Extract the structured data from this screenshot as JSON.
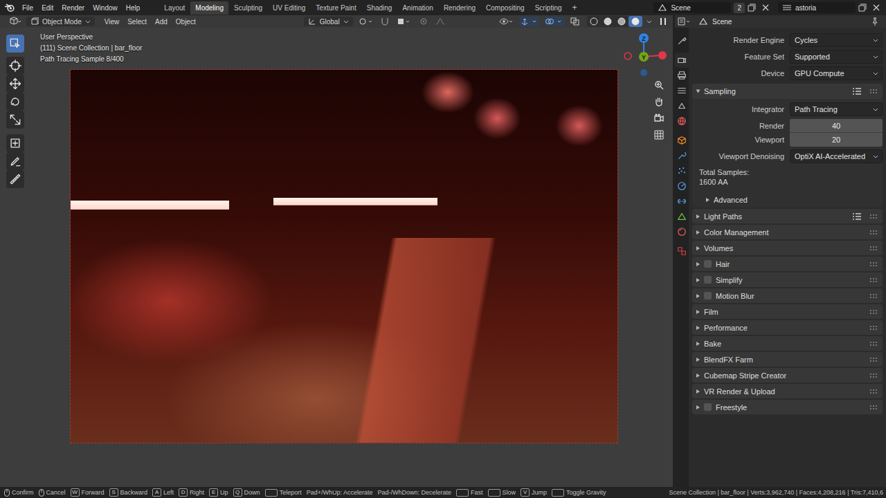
{
  "topbar": {
    "menus": [
      "File",
      "Edit",
      "Render",
      "Window",
      "Help"
    ],
    "workspaces": [
      {
        "label": "Layout",
        "selected": false
      },
      {
        "label": "Modeling",
        "selected": true
      },
      {
        "label": "Sculpting",
        "selected": false
      },
      {
        "label": "UV Editing",
        "selected": false
      },
      {
        "label": "Texture Paint",
        "selected": false
      },
      {
        "label": "Shading",
        "selected": false
      },
      {
        "label": "Animation",
        "selected": false
      },
      {
        "label": "Rendering",
        "selected": false
      },
      {
        "label": "Compositing",
        "selected": false
      },
      {
        "label": "Scripting",
        "selected": false
      }
    ],
    "add_workspace": "+",
    "scene": "Scene",
    "scene_users": "2",
    "view_layer": "astoria"
  },
  "viewport": {
    "mode": "Object Mode",
    "menus": [
      "View",
      "Select",
      "Add",
      "Object"
    ],
    "orientation": "Global",
    "shading": [
      {
        "selected": false
      },
      {
        "selected": false
      },
      {
        "selected": false
      },
      {
        "selected": true
      }
    ],
    "tools": [
      {
        "selected": true
      },
      {
        "selected": false
      },
      {
        "selected": false
      },
      {
        "selected": false
      },
      {
        "selected": false
      },
      {
        "selected": false
      },
      {
        "selected": false
      },
      {
        "selected": false
      }
    ],
    "overlay": [
      "User Perspective",
      "(111) Scene Collection | bar_floor",
      "Path Tracing Sample 8/400"
    ],
    "gizmo": {
      "z": "Z",
      "y": "Y"
    }
  },
  "properties": {
    "title": "Scene",
    "tabs": [
      {
        "color": "#bdbdbd",
        "selected": false
      },
      {
        "color": "#bdbdbd",
        "selected": true
      },
      {
        "color": "#bdbdbd",
        "selected": false
      },
      {
        "color": "#bdbdbd",
        "selected": false
      },
      {
        "color": "#bdbdbd",
        "selected": false
      },
      {
        "color": "#e05a5a",
        "selected": false
      },
      {
        "color": "#ef8a2c",
        "selected": false
      },
      {
        "color": "#5a9be0",
        "selected": false
      },
      {
        "color": "#5a9be0",
        "selected": false
      },
      {
        "color": "#5a9be0",
        "selected": false
      },
      {
        "color": "#5a9be0",
        "selected": false
      },
      {
        "color": "#6cbf4a",
        "selected": false
      },
      {
        "color": "#e05a5a",
        "selected": false
      },
      {
        "color": "#d94040",
        "selected": false
      }
    ],
    "fields": [
      {
        "kind": "dropdown",
        "label": "Render Engine",
        "value": "Cycles"
      },
      {
        "kind": "dropdown",
        "label": "Feature Set",
        "value": "Supported"
      },
      {
        "kind": "dropdown",
        "label": "Device",
        "value": "GPU Compute"
      }
    ],
    "sampling": {
      "title": "Sampling",
      "expanded": true,
      "presets": true,
      "rows": [
        {
          "kind": "dropdown",
          "label": "Integrator",
          "value": "Path Tracing"
        },
        {
          "kind": "number",
          "label": "Render",
          "value": "40"
        },
        {
          "kind": "number",
          "label": "Viewport",
          "value": "20"
        },
        {
          "kind": "dropdown",
          "label": "Viewport Denoising",
          "value": "OptiX AI-Accelerated"
        }
      ],
      "total_label": "Total Samples:",
      "total_value": "1600 AA",
      "subpanel": {
        "title": "Advanced",
        "expanded": false
      }
    },
    "panels": [
      {
        "kind": "plain",
        "title": "Light Paths",
        "expanded": false,
        "presets": true
      },
      {
        "kind": "plain",
        "title": "Color Management",
        "expanded": false,
        "presets": false
      },
      {
        "kind": "plain",
        "title": "Volumes",
        "expanded": false,
        "presets": false
      },
      {
        "kind": "checkbox",
        "title": "Hair",
        "expanded": false,
        "presets": false,
        "checked": false
      },
      {
        "kind": "checkbox",
        "title": "Simplify",
        "expanded": false,
        "presets": false,
        "checked": false
      },
      {
        "kind": "checkbox",
        "title": "Motion Blur",
        "expanded": false,
        "presets": false,
        "checked": false
      },
      {
        "kind": "plain",
        "title": "Film",
        "expanded": false,
        "presets": false
      },
      {
        "kind": "plain",
        "title": "Performance",
        "expanded": false,
        "presets": false
      },
      {
        "kind": "plain",
        "title": "Bake",
        "expanded": false,
        "presets": false
      },
      {
        "kind": "plain",
        "title": "BlendFX Farm",
        "expanded": false,
        "presets": false
      },
      {
        "kind": "plain",
        "title": "Cubemap Stripe Creator",
        "expanded": false,
        "presets": false
      },
      {
        "kind": "plain",
        "title": "VR Render & Upload",
        "expanded": false,
        "presets": false
      },
      {
        "kind": "checkbox",
        "title": "Freestyle",
        "expanded": false,
        "presets": false,
        "checked": false
      }
    ]
  },
  "status_bar": {
    "hints": [
      {
        "kind": "mouse",
        "label": "Confirm"
      },
      {
        "kind": "mouse",
        "label": "Cancel"
      },
      {
        "kind": "key",
        "key": "W",
        "label": "Forward"
      },
      {
        "kind": "key",
        "key": "S",
        "label": "Backward"
      },
      {
        "kind": "key",
        "key": "A",
        "label": "Left"
      },
      {
        "kind": "key",
        "key": "D",
        "label": "Right"
      },
      {
        "kind": "key",
        "key": "E",
        "label": "Up"
      },
      {
        "kind": "key",
        "key": "Q",
        "label": "Down"
      },
      {
        "kind": "wide",
        "label": "Teleport"
      },
      {
        "kind": "text",
        "label": "Pad+/WhUp: Accelerate"
      },
      {
        "kind": "text",
        "label": "Pad-/WhDown: Decelerate"
      },
      {
        "kind": "wide",
        "label": "Fast"
      },
      {
        "kind": "wide",
        "label": "Slow"
      },
      {
        "kind": "key",
        "key": "V",
        "label": "Jump"
      },
      {
        "kind": "wide",
        "label": "Toggle Gravity"
      }
    ],
    "info": "Scene Collection | bar_floor | Verts:3,962,740 | Faces:4,208,216 | Tris:7,410,6"
  }
}
